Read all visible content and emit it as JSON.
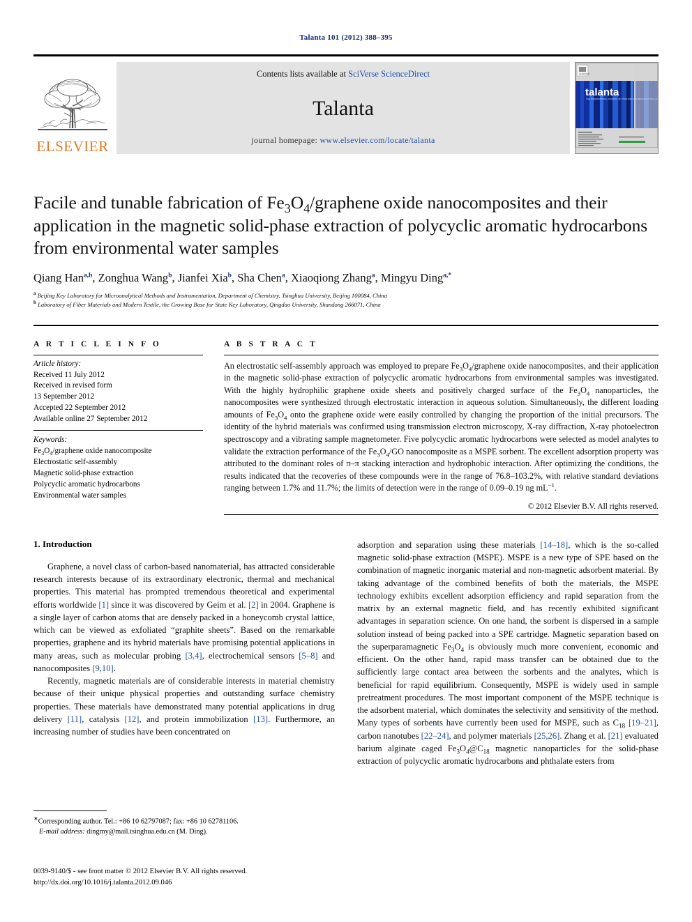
{
  "running_head": "Talanta 101 (2012) 388–395",
  "masthead": {
    "publisher_name": "ELSEVIER",
    "contents_prefix": "Contents lists available at ",
    "contents_link": "SciVerse ScienceDirect",
    "journal_title": "Talanta",
    "homepage_prefix": "journal homepage: ",
    "homepage_url": "www.elsevier.com/locate/talanta",
    "cover_wordmark": "talanta",
    "accent_orange": "#E87722",
    "link_blue": "#1f4fa8",
    "band_gray": "#e3e3e3"
  },
  "title": "Facile and tunable fabrication of Fe3O4/graphene oxide nanocomposites and their application in the magnetic solid-phase extraction of polycyclic aromatic hydrocarbons from environmental water samples",
  "authors": [
    {
      "name": "Qiang Han",
      "marks": "a,b"
    },
    {
      "name": "Zonghua Wang",
      "marks": "b"
    },
    {
      "name": "Jianfei Xia",
      "marks": "b"
    },
    {
      "name": "Sha Chen",
      "marks": "a"
    },
    {
      "name": "Xiaoqiong Zhang",
      "marks": "a"
    },
    {
      "name": "Mingyu Ding",
      "marks": "a,*"
    }
  ],
  "affiliations": [
    {
      "mark": "a",
      "text": "Beijing Key Laboratory for Microanalytical Methods and Instrumentation, Department of Chemistry, Tsinghua University, Beijing 100084, China"
    },
    {
      "mark": "b",
      "text": "Laboratory of Fiber Materials and Modern Textile, the Growing Base for State Key Laboratory, Qingdao University, Shandong 266071, China"
    }
  ],
  "article_info": {
    "heading": "A R T I C L E  I N F O",
    "history_label": "Article history:",
    "history": [
      "Received 11 July 2012",
      "Received in revised form",
      "13 September 2012",
      "Accepted 22 September 2012",
      "Available online 27 September 2012"
    ],
    "keywords_label": "Keywords:",
    "keywords": [
      "Fe3O4/graphene oxide nanocomposite",
      "Electrostatic self-assembly",
      "Magnetic solid-phase extraction",
      "Polycyclic aromatic hydrocarbons",
      "Environmental water samples"
    ]
  },
  "abstract": {
    "heading": "A B S T R A C T",
    "text": "An electrostatic self-assembly approach was employed to prepare Fe3O4/graphene oxide nanocomposites, and their application in the magnetic solid-phase extraction of polycyclic aromatic hydrocarbons from environmental samples was investigated. With the highly hydrophilic graphene oxide sheets and positively charged surface of the Fe3O4 nanoparticles, the nanocomposites were synthesized through electrostatic interaction in aqueous solution. Simultaneously, the different loading amounts of Fe3O4 onto the graphene oxide were easily controlled by changing the proportion of the initial precursors. The identity of the hybrid materials was confirmed using transmission electron microscopy, X-ray diffraction, X-ray photoelectron spectroscopy and a vibrating sample magnetometer. Five polycyclic aromatic hydrocarbons were selected as model analytes to validate the extraction performance of the Fe3O4/GO nanocomposite as a MSPE sorbent. The excellent adsorption property was attributed to the dominant roles of π–π stacking interaction and hydrophobic interaction. After optimizing the conditions, the results indicated that the recoveries of these compounds were in the range of 76.8–103.2%, with relative standard deviations ranging between 1.7% and 11.7%; the limits of detection were in the range of 0.09–0.19 ng mL−1.",
    "copyright": "© 2012 Elsevier B.V. All rights reserved."
  },
  "body": {
    "section_heading": "1.  Introduction",
    "left_paragraphs": [
      "Graphene, a novel class of carbon-based nanomaterial, has attracted considerable research interests because of its extraordinary electronic, thermal and mechanical properties. This material has prompted tremendous theoretical and experimental efforts worldwide [1] since it was discovered by Geim et al. [2] in 2004. Graphene is a single layer of carbon atoms that are densely packed in a honeycomb crystal lattice, which can be viewed as exfoliated “graphite sheets”. Based on the remarkable properties, graphene and its hybrid materials have promising potential applications in many areas, such as molecular probing [3,4], electrochemical sensors [5–8] and nanocomposites [9,10].",
      "Recently, magnetic materials are of considerable interests in material chemistry because of their unique physical properties and outstanding surface chemistry properties. These materials have demonstrated many potential applications in drug delivery [11], catalysis [12], and protein immobilization [13]. Furthermore, an increasing number of studies have been concentrated on"
    ],
    "right_paragraphs": [
      "adsorption and separation using these materials [14–18], which is the so-called magnetic solid-phase extraction (MSPE). MSPE is a new type of SPE based on the combination of magnetic inorganic material and non-magnetic adsorbent material. By taking advantage of the combined benefits of both the materials, the MSPE technology exhibits excellent adsorption efficiency and rapid separation from the matrix by an external magnetic field, and has recently exhibited significant advantages in separation science. On one hand, the sorbent is dispersed in a sample solution instead of being packed into a SPE cartridge. Magnetic separation based on the superparamagnetic Fe3O4 is obviously much more convenient, economic and efficient. On the other hand, rapid mass transfer can be obtained due to the sufficiently large contact area between the sorbents and the analytes, which is beneficial for rapid equilibrium. Consequently, MSPE is widely used in sample pretreatment procedures. The most important component of the MSPE technique is the adsorbent material, which dominates the selectivity and sensitivity of the method. Many types of sorbents have currently been used for MSPE, such as C18 [19–21], carbon nanotubes [22–24], and polymer materials [25,26]. Zhang et al. [21] evaluated barium alginate caged Fe3O4@C18 magnetic nanoparticles for the solid-phase extraction of polycyclic aromatic hydrocarbons and phthalate esters from"
    ]
  },
  "footnote": {
    "corresponding": "Corresponding author. Tel.: +86 10 62797087; fax: +86 10 62781106.",
    "email_label": "E-mail address:",
    "email": "dingmy@mail.tsinghua.edu.cn (M. Ding)."
  },
  "imprint": {
    "line1": "0039-9140/$ - see front matter © 2012 Elsevier B.V. All rights reserved.",
    "line2": "http://dx.doi.org/10.1016/j.talanta.2012.09.046"
  }
}
